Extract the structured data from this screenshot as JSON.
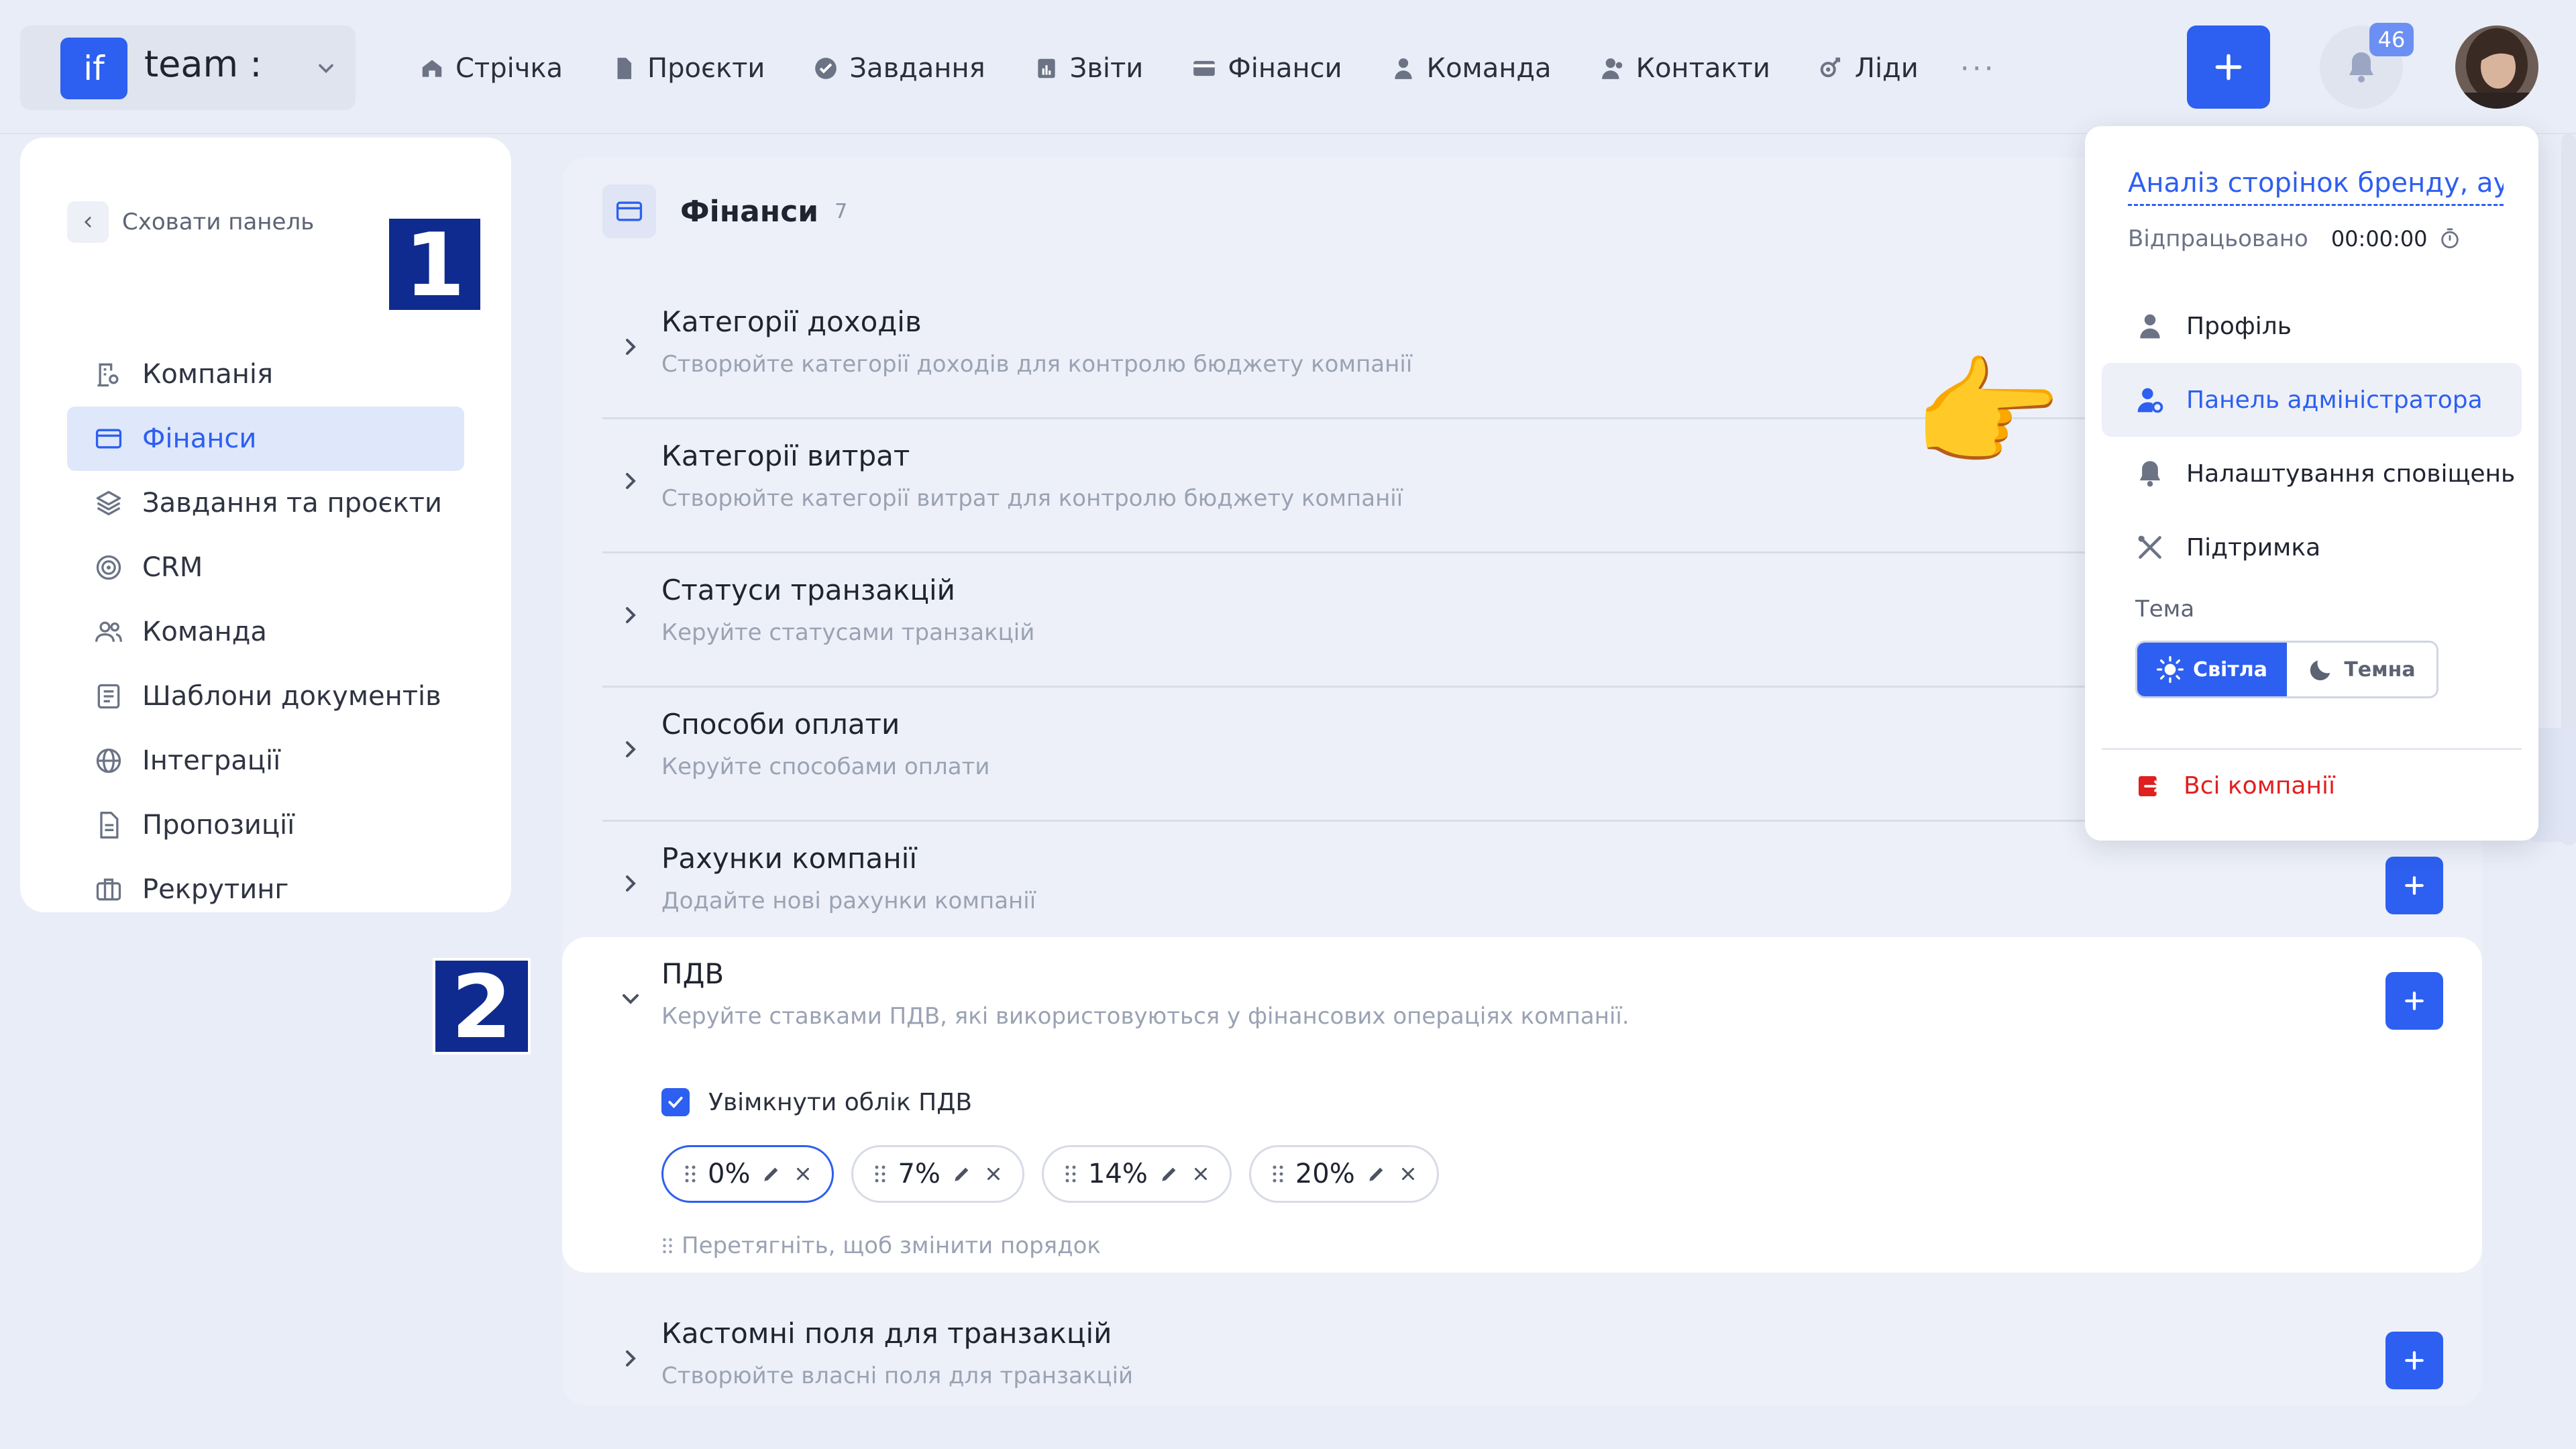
{
  "brand": {
    "logo": "if",
    "name": "team :"
  },
  "nav": [
    {
      "label": "Стрічка",
      "icon": "home-icon"
    },
    {
      "label": "Проєкти",
      "icon": "document-icon"
    },
    {
      "label": "Завдання",
      "icon": "check-circle-icon"
    },
    {
      "label": "Звіти",
      "icon": "report-icon"
    },
    {
      "label": "Фінанси",
      "icon": "card-icon"
    },
    {
      "label": "Команда",
      "icon": "user-icon"
    },
    {
      "label": "Контакти",
      "icon": "contacts-icon"
    },
    {
      "label": "Ліди",
      "icon": "leads-icon"
    }
  ],
  "nav_more": "···",
  "notifications": {
    "count": "46"
  },
  "sidebar": {
    "hide_label": "Сховати панель",
    "items": [
      {
        "label": "Компанія",
        "icon": "company-icon",
        "active": false
      },
      {
        "label": "Фінанси",
        "icon": "card-icon",
        "active": true
      },
      {
        "label": "Завдання та проєкти",
        "icon": "layers-icon",
        "active": false
      },
      {
        "label": "CRM",
        "icon": "target-icon",
        "active": false
      },
      {
        "label": "Команда",
        "icon": "team-icon",
        "active": false
      },
      {
        "label": "Шаблони документів",
        "icon": "template-icon",
        "active": false
      },
      {
        "label": "Інтеграції",
        "icon": "globe-icon",
        "active": false
      },
      {
        "label": "Пропозиції",
        "icon": "proposal-icon",
        "active": false
      },
      {
        "label": "Рекрутинг",
        "icon": "briefcase-icon",
        "active": false
      }
    ]
  },
  "markers": {
    "one": "1",
    "two": "2"
  },
  "main": {
    "title": "Фінанси",
    "count": "7",
    "sections": [
      {
        "title": "Категорії доходів",
        "subtitle": "Створюйте категорії доходів для контролю бюджету компанії"
      },
      {
        "title": "Категорії витрат",
        "subtitle": "Створюйте категорії витрат для контролю бюджету компанії"
      },
      {
        "title": "Статуси транзакцій",
        "subtitle": "Керуйте статусами транзакцій"
      },
      {
        "title": "Способи оплати",
        "subtitle": "Керуйте способами оплати"
      },
      {
        "title": "Рахунки компанії",
        "subtitle": "Додайте нові рахунки компанії"
      }
    ],
    "vat": {
      "title": "ПДВ",
      "subtitle": "Керуйте ставками ПДВ, які використовуються у фінансових операціях компанії.",
      "enable_label": "Увімкнути облік ПДВ",
      "enabled": true,
      "rates": [
        "0%",
        "7%",
        "14%",
        "20%"
      ],
      "drag_hint": "Перетягніть, щоб змінити порядок"
    },
    "custom_fields": {
      "title": "Кастомні поля для транзакцій",
      "subtitle": "Створюйте власні поля для транзакцій"
    }
  },
  "dropdown": {
    "task": "Аналіз сторінок бренду, ау...",
    "worked_label": "Відпрацьовано",
    "worked_value": "00:00:00",
    "items": [
      {
        "label": "Профіль",
        "icon": "user-icon",
        "active": false
      },
      {
        "label": "Панель адміністратора",
        "icon": "admin-icon",
        "active": true
      },
      {
        "label": "Налаштування сповіщень",
        "icon": "bell-icon",
        "active": false
      },
      {
        "label": "Підтримка",
        "icon": "tools-icon",
        "active": false
      }
    ],
    "theme_label": "Тема",
    "theme_light": "Світла",
    "theme_dark": "Темна",
    "all_companies": "Всі компанії"
  },
  "colors": {
    "accent": "#2d5ff0",
    "danger": "#e02020",
    "marker": "#0f2b8f"
  }
}
